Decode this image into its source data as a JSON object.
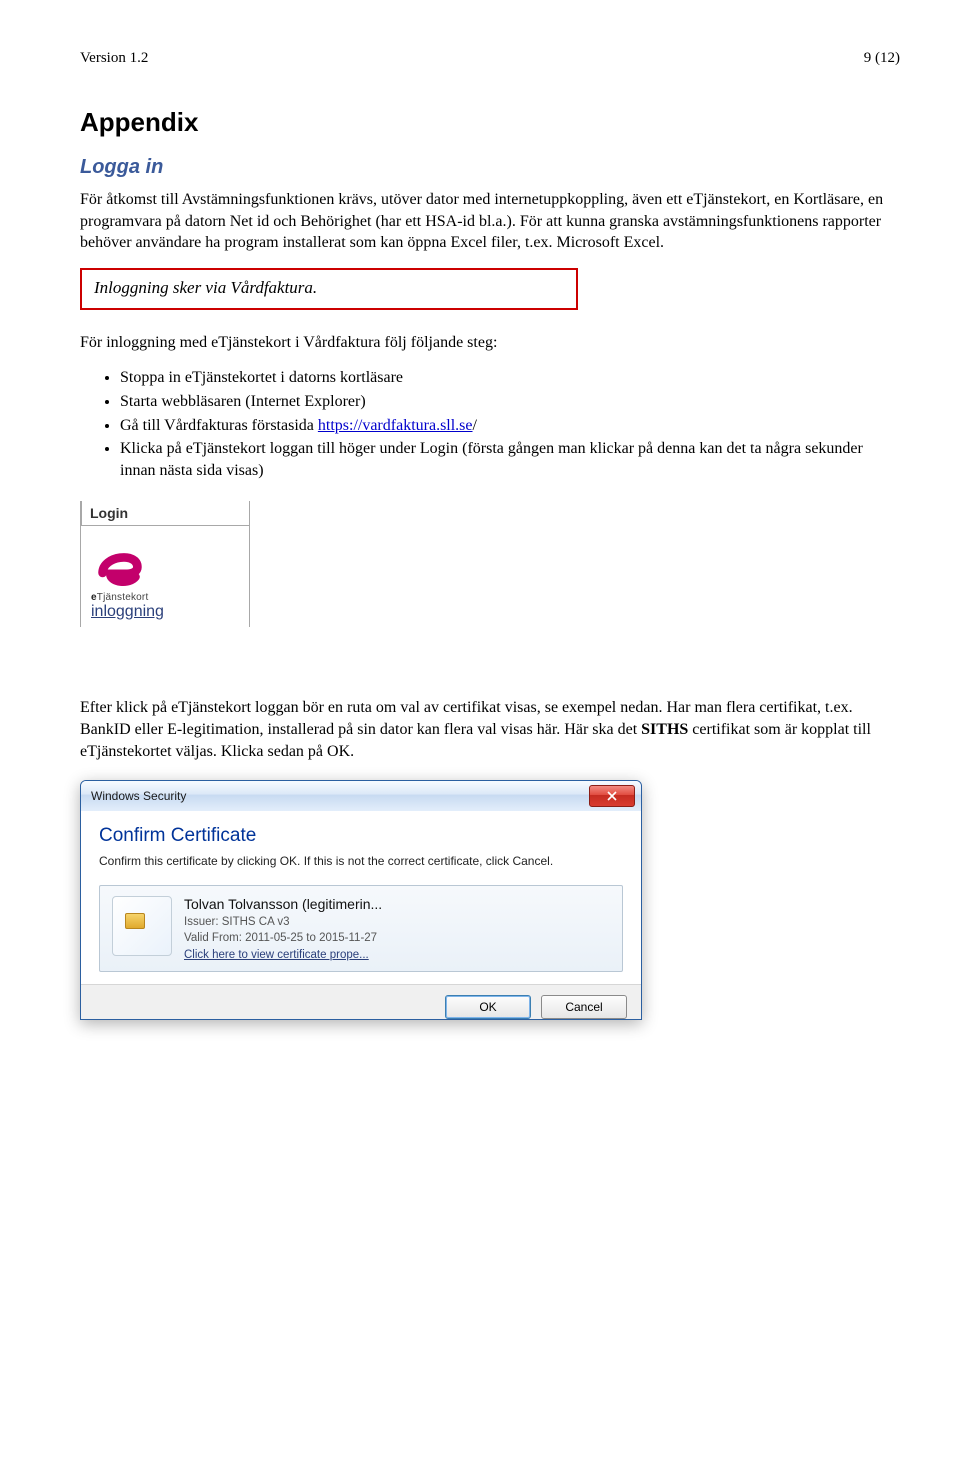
{
  "header": {
    "left": "Version 1.2",
    "right": "9 (12)"
  },
  "h1": "Appendix",
  "h2": "Logga in",
  "para1": "För åtkomst till Avstämningsfunktionen krävs, utöver dator med internetuppkoppling, även ett eTjänstekort, en Kortläsare, en programvara på datorn Net id och Behörighet (har ett HSA-id bl.a.). För att kunna granska avstämningsfunktionens rapporter behöver användare ha program installerat som kan öppna Excel filer, t.ex. Microsoft Excel.",
  "notebox": "Inloggning sker via Vårdfaktura.",
  "para_steps_intro": "För inloggning med eTjänstekort i Vårdfaktura följ följande steg:",
  "bullets": [
    "Stoppa in eTjänstekortet i datorns kortläsare",
    "Starta webbläsaren (Internet Explorer)"
  ],
  "bullet_link_prefix": "Gå till Vårdfakturas förstasida ",
  "bullet_link_text": "https://vardfaktura.sll.se",
  "bullet_link_suffix": "/",
  "bullet_last": "Klicka på eTjänstekort loggan till höger under Login (första gången man klickar på denna kan det ta några sekunder innan nästa sida visas)",
  "login_widget": {
    "title": "Login",
    "brand_e": "e",
    "brand_rest": "Tjänstekort",
    "link": "inloggning"
  },
  "para_after": "Efter klick på eTjänstekort loggan bör en ruta om val av certifikat visas, se exempel nedan. Har man flera certifikat, t.ex. BankID eller E-legitimation, installerad på sin dator kan flera val visas här. Här ska det ",
  "para_after_bold": "SITHS",
  "para_after_tail": " certifikat som är kopplat till eTjänstekortet väljas. Klicka sedan på OK.",
  "dialog": {
    "titlebar": "Windows Security",
    "heading": "Confirm Certificate",
    "instruction": "Confirm this certificate by clicking OK. If this is not the correct certificate, click Cancel.",
    "cert_name": "Tolvan Tolvansson (legitimerin...",
    "issuer_label": "Issuer: ",
    "issuer_value": "SITHS CA v3",
    "valid_label": "Valid From: ",
    "valid_value": "2011-05-25 to 2015-11-27",
    "cert_link": "Click here to view certificate prope...",
    "ok": "OK",
    "cancel": "Cancel"
  }
}
